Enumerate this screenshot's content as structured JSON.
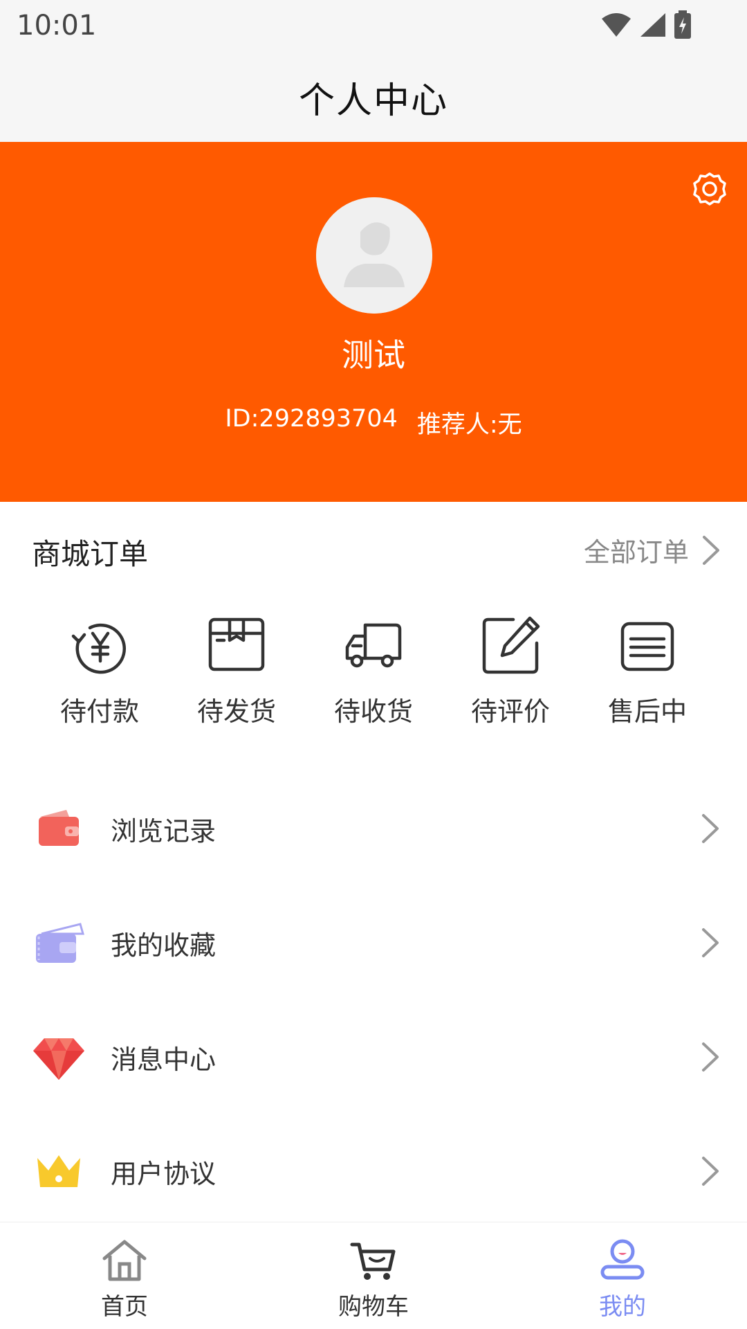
{
  "status_bar": {
    "time": "10:01"
  },
  "header": {
    "title": "个人中心"
  },
  "profile": {
    "username": "测试",
    "id_text": "ID:292893704",
    "referrer_text": "推荐人:无",
    "background_color": "#ff5a00"
  },
  "orders": {
    "title": "商城订单",
    "all_label": "全部订单",
    "items": [
      {
        "label": "待付款",
        "icon": "yen-icon"
      },
      {
        "label": "待发货",
        "icon": "box-icon"
      },
      {
        "label": "待收货",
        "icon": "truck-icon"
      },
      {
        "label": "待评价",
        "icon": "edit-icon"
      },
      {
        "label": "售后中",
        "icon": "list-card-icon"
      }
    ]
  },
  "menu": [
    {
      "label": "浏览记录",
      "icon": "wallet-red-icon"
    },
    {
      "label": "我的收藏",
      "icon": "wallet-purple-icon"
    },
    {
      "label": "消息中心",
      "icon": "diamond-icon"
    },
    {
      "label": "用户协议",
      "icon": "crown-icon"
    }
  ],
  "tabbar": {
    "items": [
      {
        "label": "首页",
        "icon": "home-icon"
      },
      {
        "label": "购物车",
        "icon": "cart-icon"
      },
      {
        "label": "我的",
        "icon": "profile-icon"
      }
    ],
    "active_index": 2,
    "active_color": "#7b8cf2"
  }
}
